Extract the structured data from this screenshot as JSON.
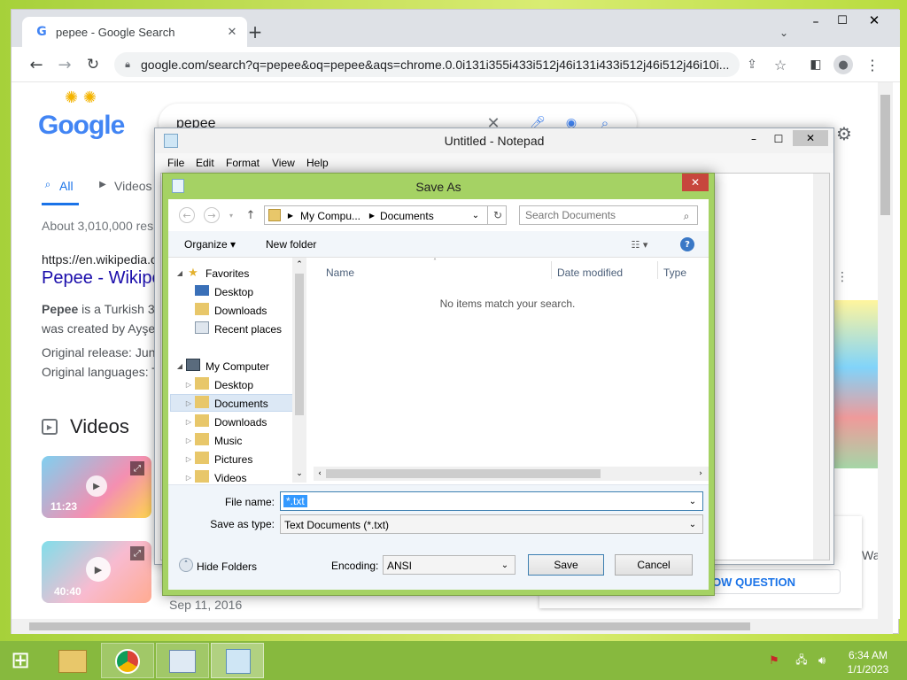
{
  "browser": {
    "tab_title": "pepee - Google Search",
    "url": "google.com/search?q=pepee&oq=pepee&aqs=chrome.0.0i131i355i433i512j46i131i433i512j46i512j46i10i...",
    "search_query": "pepee",
    "logo": "Google",
    "filter_all": "All",
    "filter_videos": "Videos",
    "result_stats": "About 3,010,000 resu",
    "result_url": "https://en.wikipedia.c",
    "result_title": "Pepee - Wikipe",
    "snippet_bold": "Pepee",
    "snippet_rest": " is a Turkish 3",
    "snippet_line2": "was created by Ayşe",
    "release": "Original release: Jun",
    "languages": "Original languages: T",
    "videos_heading": "Videos",
    "video1_duration": "11:23",
    "video2_duration": "40:40",
    "date_text": "Sep 11, 2016",
    "show_question": "SHOW QUESTION",
    "right_edge_text": "Wa"
  },
  "notepad": {
    "title": "Untitled - Notepad",
    "menu": [
      "File",
      "Edit",
      "Format",
      "View",
      "Help"
    ]
  },
  "saveas": {
    "title": "Save As",
    "breadcrumb": [
      "My Compu...",
      "Documents"
    ],
    "search_placeholder": "Search Documents",
    "organize": "Organize",
    "new_folder": "New folder",
    "nav": {
      "favorites": "Favorites",
      "fav_items": [
        "Desktop",
        "Downloads",
        "Recent places"
      ],
      "computer": "My Computer",
      "comp_items": [
        "Desktop",
        "Documents",
        "Downloads",
        "Music",
        "Pictures",
        "Videos"
      ]
    },
    "columns": [
      "Name",
      "Date modified",
      "Type"
    ],
    "empty_message": "No items match your search.",
    "file_name_label": "File name:",
    "file_name_value": "*.txt",
    "save_type_label": "Save as type:",
    "save_type_value": "Text Documents (*.txt)",
    "hide_folders": "Hide Folders",
    "encoding_label": "Encoding:",
    "encoding_value": "ANSI",
    "save_button": "Save",
    "cancel_button": "Cancel"
  },
  "taskbar": {
    "time": "6:34 AM",
    "date": "1/1/2023"
  }
}
